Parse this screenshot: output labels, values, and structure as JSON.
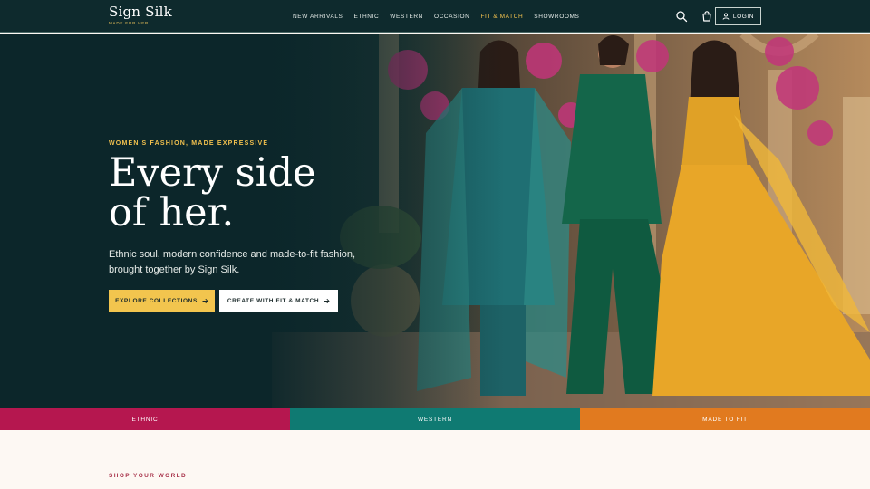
{
  "brand": {
    "name": "Sign Silk",
    "tagline": "MADE FOR HER"
  },
  "nav": {
    "items": [
      {
        "label": "NEW ARRIVALS",
        "active": false
      },
      {
        "label": "ETHNIC",
        "active": false
      },
      {
        "label": "WESTERN",
        "active": false
      },
      {
        "label": "OCCASION",
        "active": false
      },
      {
        "label": "FIT & MATCH",
        "active": true
      },
      {
        "label": "SHOWROOMS",
        "active": false
      }
    ]
  },
  "header": {
    "icons": [
      "search-icon",
      "cart-icon"
    ],
    "login_label": "LOGIN"
  },
  "hero": {
    "eyebrow": "WOMEN'S FASHION, MADE EXPRESSIVE",
    "headline_line1": "Every side",
    "headline_line2": "of her.",
    "subcopy": "Ethnic soul, modern confidence and made-to-fit fashion, brought together by Sign Silk.",
    "primary_cta": "EXPLORE COLLECTIONS",
    "secondary_cta": "CREATE WITH FIT & MATCH"
  },
  "categories": [
    {
      "label": "ETHNIC",
      "color": "#b5174f"
    },
    {
      "label": "WESTERN",
      "color": "#0f7a72"
    },
    {
      "label": "MADE TO FIT",
      "color": "#e17a1f"
    }
  ],
  "colors": {
    "header_bg": "#0e2a2d",
    "accent_gold": "#f2c14e",
    "section_label": "#a8324a",
    "page_bg": "#fdf8f3"
  },
  "section": {
    "label": "SHOP YOUR WORLD"
  }
}
